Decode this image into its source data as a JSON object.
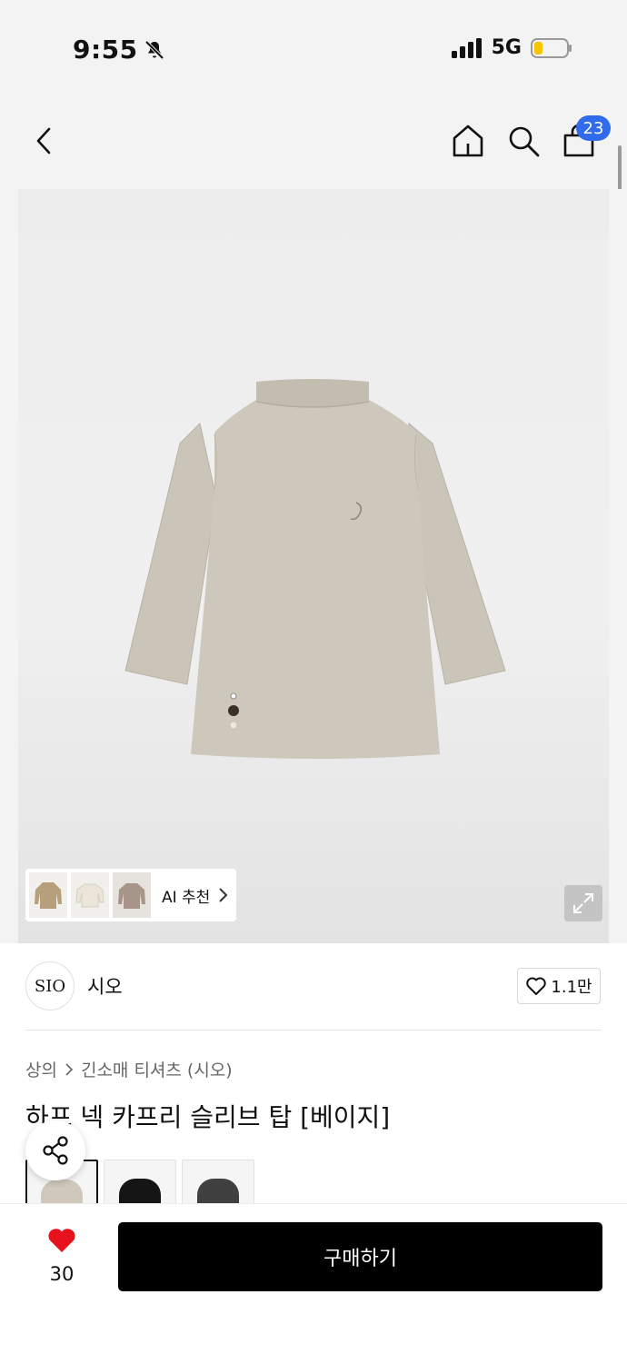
{
  "status_bar": {
    "time": "9:55",
    "network": "5G"
  },
  "nav": {
    "cart_count": "23"
  },
  "ai_recommend": {
    "label": "AI 추천"
  },
  "brand": {
    "logo_text": "SIO",
    "name": "시오",
    "like_count": "1.1만"
  },
  "breadcrumb": {
    "category": "상의",
    "subcategory": "긴소매 티셔츠 (시오)"
  },
  "product": {
    "title": "하프 넥 카프리 슬리브 탑 [베이지]"
  },
  "colors": {
    "accent_blue": "#2f6bea",
    "heart_red": "#e8121f",
    "garment_beige": "#cdc7bb"
  },
  "bottom_bar": {
    "wish_count": "30",
    "buy_label": "구매하기"
  },
  "icons": [
    "bell-slash-icon",
    "signal-icon",
    "battery-icon",
    "back-icon",
    "home-icon",
    "search-icon",
    "cart-icon",
    "expand-icon",
    "heart-outline-icon",
    "share-icon",
    "heart-filled-icon",
    "chevron-right-icon"
  ]
}
